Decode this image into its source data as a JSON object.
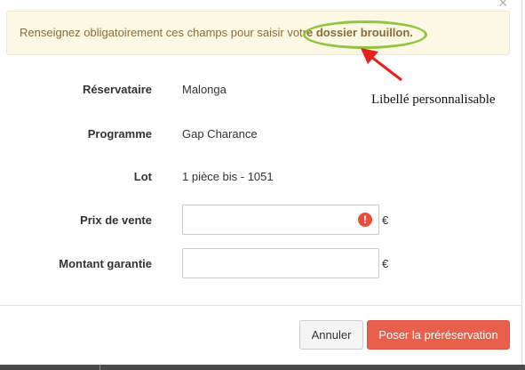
{
  "alert": {
    "text_before": "Renseignez obligatoirement ces champs pour saisir votr",
    "text_bold": "e dossier brouillon."
  },
  "annotation": {
    "label": "Libellé personnalisable"
  },
  "form": {
    "reservataire": {
      "label": "Réservataire",
      "value": "Malonga"
    },
    "programme": {
      "label": "Programme",
      "value": "Gap Charance"
    },
    "lot": {
      "label": "Lot",
      "value": "1 pièce bis - 1051"
    },
    "prix_de_vente": {
      "label": "Prix de vente",
      "value": "",
      "currency": "€",
      "error_icon": "!"
    },
    "montant_garantie": {
      "label": "Montant garantie",
      "value": "",
      "currency": "€"
    }
  },
  "footer": {
    "cancel_label": "Annuler",
    "submit_label": "Poser la préréservation"
  },
  "icons": {
    "close": "×",
    "error": "exclamation-circle-icon",
    "arrow": "red-arrow-icon"
  },
  "colors": {
    "alert_bg": "#fcf8e3",
    "alert_text": "#8a6d3b",
    "highlight": "#8dc63f",
    "arrow": "#e8201e",
    "primary": "#e8604c",
    "error": "#e74c3c"
  }
}
